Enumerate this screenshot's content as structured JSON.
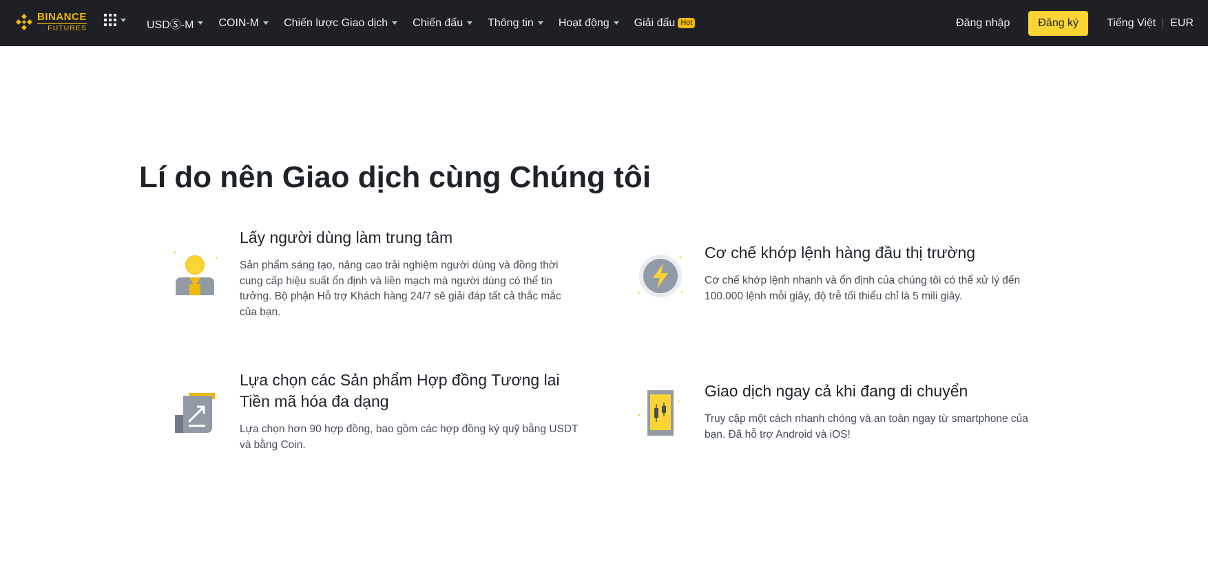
{
  "navbar": {
    "logo": {
      "main": "BINANCE",
      "sub": "FUTURES"
    },
    "apps_icon": "grid-icon",
    "items": [
      {
        "label": "USDⓈ-M",
        "dropdown": true
      },
      {
        "label": "COIN-M",
        "dropdown": true
      },
      {
        "label": "Chiến lược Giao dịch",
        "dropdown": true
      },
      {
        "label": "Chiến đấu",
        "dropdown": true
      },
      {
        "label": "Thông tin",
        "dropdown": true
      },
      {
        "label": "Hoạt động",
        "dropdown": true
      },
      {
        "label": "Giải đấu",
        "badge": "Hot"
      }
    ],
    "login": "Đăng nhập",
    "signup": "Đăng ký",
    "language": "Tiếng Việt",
    "currency": "EUR"
  },
  "colors": {
    "brand": "#f0b90b",
    "button": "#fcd535",
    "nav_bg": "#1e2026"
  },
  "section": {
    "title": "Lí do nên Giao dịch cùng Chúng tôi",
    "features": [
      {
        "icon": "user-icon",
        "title": "Lấy người dùng làm trung tâm",
        "desc": "Sản phẩm sáng tạo, nâng cao trải nghiệm người dùng và đồng thời cung cấp hiệu suất ổn định và liền mạch mà người dùng có thể tin tưởng. Bộ phận Hỗ trợ Khách hàng 24/7 sẽ giải đáp tất cả thắc mắc của bạn."
      },
      {
        "icon": "lightning-icon",
        "title": "Cơ chế khớp lệnh hàng đầu thị trường",
        "desc": "Cơ chế khớp lệnh nhanh và ổn định của chúng tôi có thể xử lý đến 100.000 lệnh mỗi giây, độ trễ tối thiểu chỉ là 5 mili giây."
      },
      {
        "icon": "contract-chart-icon",
        "title": "Lựa chọn các Sản phẩm Hợp đồng Tương lai Tiền mã hóa đa dạng",
        "desc": "Lựa chọn hơn 90 hợp đồng, bao gồm các hợp đồng ký quỹ bằng USDT và bằng Coin."
      },
      {
        "icon": "mobile-candlestick-icon",
        "title": "Giao dịch ngay cả khi đang di chuyển",
        "desc": "Truy cập một cách nhanh chóng và an toàn ngay từ smartphone của bạn. Đã hỗ trợ Android và iOS!"
      }
    ]
  }
}
